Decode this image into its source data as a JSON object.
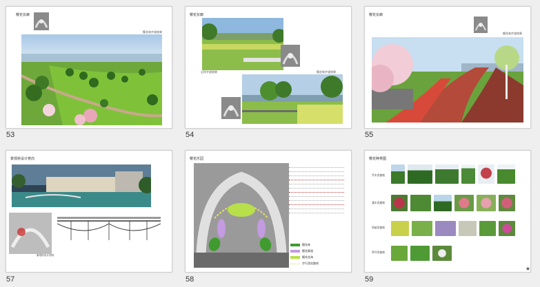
{
  "slides": [
    {
      "number": "53",
      "title": "樱花长廊",
      "caption": "樱花林步道效果",
      "selected": false
    },
    {
      "number": "54",
      "title": "樱花长廊",
      "caption_top": "樱花林步道效果",
      "caption_left": "沿岸步道效果",
      "selected": false
    },
    {
      "number": "55",
      "title": "樱花长廊",
      "caption": "樱花林步道效果",
      "selected": false
    },
    {
      "number": "57",
      "title": "景观桥设计意向",
      "caption": "景观桥设计说明",
      "selected": false
    },
    {
      "number": "58",
      "title": "樱花乐园",
      "selected": false,
      "legend": [
        {
          "label": "樱花林",
          "color": "#3f9b2d"
        },
        {
          "label": "樱花廊道",
          "color": "#c39be0"
        },
        {
          "label": "樱花花海",
          "color": "#b8e04a"
        },
        {
          "label": "步行游览路线",
          "color": "#d8d84a"
        }
      ]
    },
    {
      "number": "59",
      "title": "樱花种类图",
      "selected": true,
      "star": "★",
      "rows": [
        "乔木类植物",
        "灌木类植物",
        "地被类植物",
        "草坪类植物"
      ]
    }
  ],
  "colors": {
    "accent_red": "#c43a3a",
    "legend_green": "#3f9b2d",
    "legend_purple": "#c39be0",
    "legend_lime": "#b8e04a",
    "legend_yellow": "#d8d84a"
  }
}
